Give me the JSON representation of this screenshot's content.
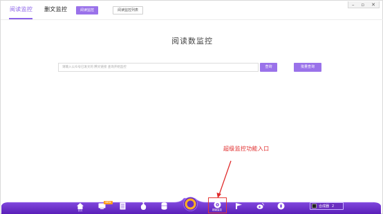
{
  "tabs": [
    {
      "label": "阅读监控"
    },
    {
      "label": "删文监控"
    }
  ],
  "toolbar": {
    "read_monitor_btn": "阅读监控",
    "monitor_list_btn": "阅读监控列表"
  },
  "window_controls": {
    "minimize": "–",
    "restore": "▫",
    "close": "✕"
  },
  "main": {
    "title": "阅读数监控",
    "search_placeholder": "请输入公众号已发文的 腾文链接 查询开始监控",
    "search_btn": "查询",
    "batch_btn": "批量查询"
  },
  "annotation": {
    "text": "超级监控功能入口",
    "color": "#e02b2b"
  },
  "dock": {
    "items": [
      {
        "label": "首页",
        "icon": "home-icon"
      },
      {
        "label": "",
        "icon": "monitor-icon",
        "badge": "NEW"
      },
      {
        "label": "",
        "icon": "document-icon"
      },
      {
        "label": "",
        "icon": "bag-icon"
      },
      {
        "label": "",
        "icon": "database-icon"
      },
      {
        "label": "",
        "icon": "logo-icon"
      },
      {
        "label": "超级监控",
        "icon": "super-monitor-icon"
      },
      {
        "label": "",
        "icon": "flag-icon"
      },
      {
        "label": "",
        "icon": "weibo-icon"
      },
      {
        "label": "",
        "icon": "compass-icon"
      }
    ],
    "synth_label": "合成器",
    "synth_count": "2"
  },
  "colors": {
    "accent": "#9a72ea",
    "dock_bg": "#7b3fdc",
    "highlight": "#e53935"
  }
}
